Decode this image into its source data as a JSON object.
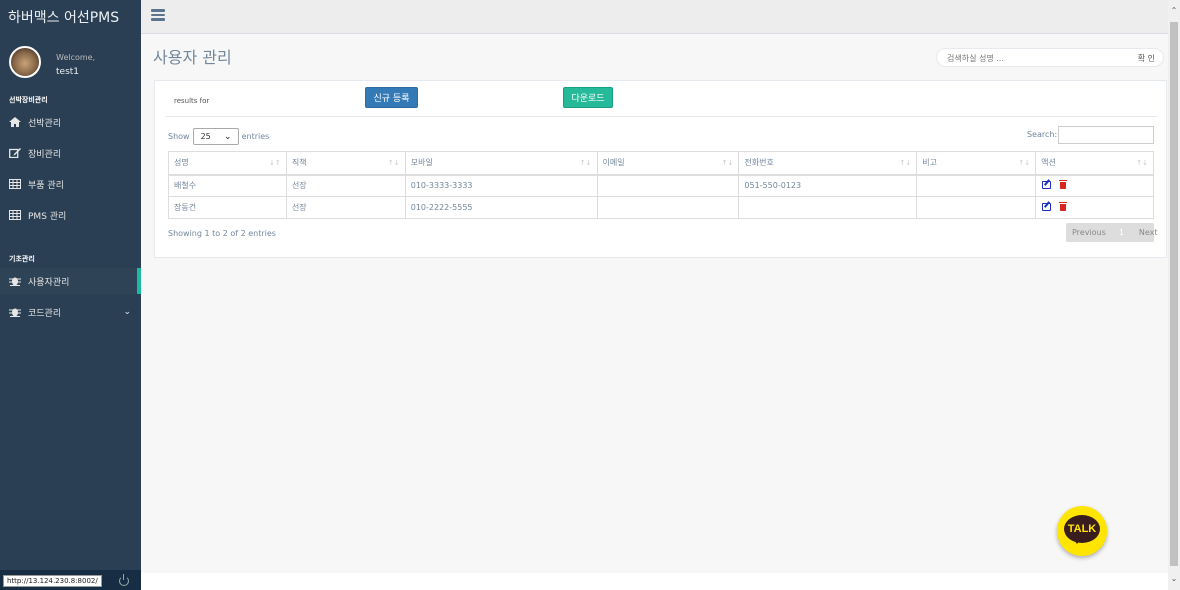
{
  "sidebar": {
    "brand": "하버맥스 어선PMS",
    "welcome": "Welcome,",
    "username": "test1",
    "section1": "선박장비관리",
    "section1_items": [
      {
        "label": "선박관리",
        "icon": "home-icon"
      },
      {
        "label": "장비관리",
        "icon": "edit-icon"
      },
      {
        "label": "부품 관리",
        "icon": "table-icon"
      },
      {
        "label": "PMS 관리",
        "icon": "table-icon"
      }
    ],
    "section2": "기초관리",
    "section2_items": [
      {
        "label": "사용자관리",
        "icon": "bug-icon"
      },
      {
        "label": "코드관리",
        "icon": "bug-icon"
      }
    ],
    "status_url": "http://13.124.230.8:8002/"
  },
  "page": {
    "title": "사용자 관리",
    "search_placeholder": "검색하실 성명 ...",
    "search_button": "확 인"
  },
  "panel": {
    "results_for": "results for",
    "new_button": "신규 등록",
    "download_button": "다운로드",
    "show": "Show",
    "entries_count": "25",
    "entries": "entries",
    "search_label": "Search:",
    "columns": [
      "성명",
      "직책",
      "모바일",
      "이메일",
      "전화번호",
      "비고",
      "액션"
    ],
    "rows": [
      [
        "배철수",
        "선장",
        "010-3333-3333",
        "",
        "051-550-0123",
        ""
      ],
      [
        "장동건",
        "선장",
        "010-2222-5555",
        "",
        "",
        ""
      ]
    ],
    "info": "Showing 1 to 2 of 2 entries",
    "pager": {
      "previous": "Previous",
      "page": "1",
      "next": "Next"
    }
  },
  "talk": {
    "label": "TALK"
  },
  "colors": {
    "sidebar": "#2A3F54",
    "accent": "#1ABB9C",
    "primary": "#337AB7",
    "success": "#26B99A",
    "talk": "#FFE500"
  }
}
